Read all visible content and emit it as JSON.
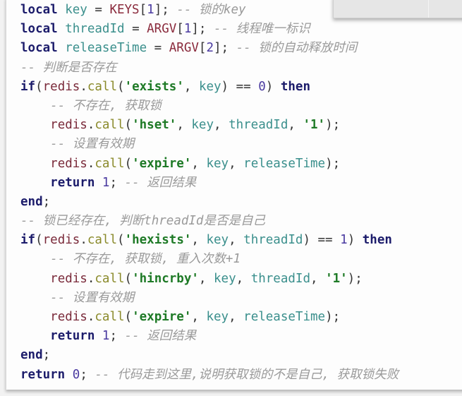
{
  "code": {
    "lines": [
      [
        [
          "kw",
          "local"
        ],
        [
          "punc",
          " "
        ],
        [
          "var",
          "key"
        ],
        [
          "punc",
          " = "
        ],
        [
          "glob",
          "KEYS"
        ],
        [
          "punc",
          "["
        ],
        [
          "num",
          "1"
        ],
        [
          "punc",
          "]; "
        ],
        [
          "cmt",
          "-- 锁的key"
        ]
      ],
      [
        [
          "kw",
          "local"
        ],
        [
          "punc",
          " "
        ],
        [
          "var",
          "threadId"
        ],
        [
          "punc",
          " = "
        ],
        [
          "glob",
          "ARGV"
        ],
        [
          "punc",
          "["
        ],
        [
          "num",
          "1"
        ],
        [
          "punc",
          "]; "
        ],
        [
          "cmt",
          "-- 线程唯一标识"
        ]
      ],
      [
        [
          "kw",
          "local"
        ],
        [
          "punc",
          " "
        ],
        [
          "var",
          "releaseTime"
        ],
        [
          "punc",
          " = "
        ],
        [
          "glob",
          "ARGV"
        ],
        [
          "punc",
          "["
        ],
        [
          "num",
          "2"
        ],
        [
          "punc",
          "]; "
        ],
        [
          "cmt",
          "-- 锁的自动释放时间"
        ]
      ],
      [
        [
          "cmt",
          "-- 判断是否存在"
        ]
      ],
      [
        [
          "kw",
          "if"
        ],
        [
          "punc",
          "("
        ],
        [
          "obj",
          "redis"
        ],
        [
          "punc",
          "."
        ],
        [
          "fn",
          "call"
        ],
        [
          "punc",
          "("
        ],
        [
          "str",
          "'exists'"
        ],
        [
          "punc",
          ", "
        ],
        [
          "var",
          "key"
        ],
        [
          "punc",
          ") == "
        ],
        [
          "num",
          "0"
        ],
        [
          "punc",
          ") "
        ],
        [
          "kw",
          "then"
        ]
      ],
      [
        [
          "punc",
          "    "
        ],
        [
          "cmt",
          "-- 不存在, 获取锁"
        ]
      ],
      [
        [
          "punc",
          "    "
        ],
        [
          "obj",
          "redis"
        ],
        [
          "punc",
          "."
        ],
        [
          "fn",
          "call"
        ],
        [
          "punc",
          "("
        ],
        [
          "str",
          "'hset'"
        ],
        [
          "punc",
          ", "
        ],
        [
          "var",
          "key"
        ],
        [
          "punc",
          ", "
        ],
        [
          "var",
          "threadId"
        ],
        [
          "punc",
          ", "
        ],
        [
          "str",
          "'1'"
        ],
        [
          "punc",
          ");"
        ]
      ],
      [
        [
          "punc",
          "    "
        ],
        [
          "cmt",
          "-- 设置有效期"
        ]
      ],
      [
        [
          "punc",
          "    "
        ],
        [
          "obj",
          "redis"
        ],
        [
          "punc",
          "."
        ],
        [
          "fn",
          "call"
        ],
        [
          "punc",
          "("
        ],
        [
          "str",
          "'expire'"
        ],
        [
          "punc",
          ", "
        ],
        [
          "var",
          "key"
        ],
        [
          "punc",
          ", "
        ],
        [
          "var",
          "releaseTime"
        ],
        [
          "punc",
          ");"
        ]
      ],
      [
        [
          "punc",
          "    "
        ],
        [
          "kw",
          "return"
        ],
        [
          "punc",
          " "
        ],
        [
          "num",
          "1"
        ],
        [
          "punc",
          "; "
        ],
        [
          "cmt",
          "-- 返回结果"
        ]
      ],
      [
        [
          "kw",
          "end"
        ],
        [
          "punc",
          ";"
        ]
      ],
      [
        [
          "cmt",
          "-- 锁已经存在, 判断threadId是否是自己"
        ]
      ],
      [
        [
          "kw",
          "if"
        ],
        [
          "punc",
          "("
        ],
        [
          "obj",
          "redis"
        ],
        [
          "punc",
          "."
        ],
        [
          "fn",
          "call"
        ],
        [
          "punc",
          "("
        ],
        [
          "str",
          "'hexists'"
        ],
        [
          "punc",
          ", "
        ],
        [
          "var",
          "key"
        ],
        [
          "punc",
          ", "
        ],
        [
          "var",
          "threadId"
        ],
        [
          "punc",
          ") == "
        ],
        [
          "num",
          "1"
        ],
        [
          "punc",
          ") "
        ],
        [
          "kw",
          "then"
        ]
      ],
      [
        [
          "punc",
          "    "
        ],
        [
          "cmt",
          "-- 不存在, 获取锁, 重入次数+1"
        ]
      ],
      [
        [
          "punc",
          "    "
        ],
        [
          "obj",
          "redis"
        ],
        [
          "punc",
          "."
        ],
        [
          "fn",
          "call"
        ],
        [
          "punc",
          "("
        ],
        [
          "str",
          "'hincrby'"
        ],
        [
          "punc",
          ", "
        ],
        [
          "var",
          "key"
        ],
        [
          "punc",
          ", "
        ],
        [
          "var",
          "threadId"
        ],
        [
          "punc",
          ", "
        ],
        [
          "str",
          "'1'"
        ],
        [
          "punc",
          ");"
        ]
      ],
      [
        [
          "punc",
          "    "
        ],
        [
          "cmt",
          "-- 设置有效期"
        ]
      ],
      [
        [
          "punc",
          "    "
        ],
        [
          "obj",
          "redis"
        ],
        [
          "punc",
          "."
        ],
        [
          "fn",
          "call"
        ],
        [
          "punc",
          "("
        ],
        [
          "str",
          "'expire'"
        ],
        [
          "punc",
          ", "
        ],
        [
          "var",
          "key"
        ],
        [
          "punc",
          ", "
        ],
        [
          "var",
          "releaseTime"
        ],
        [
          "punc",
          ");"
        ]
      ],
      [
        [
          "punc",
          "    "
        ],
        [
          "kw",
          "return"
        ],
        [
          "punc",
          " "
        ],
        [
          "num",
          "1"
        ],
        [
          "punc",
          "; "
        ],
        [
          "cmt",
          "-- 返回结果"
        ]
      ],
      [
        [
          "kw",
          "end"
        ],
        [
          "punc",
          ";"
        ]
      ],
      [
        [
          "kw",
          "return"
        ],
        [
          "punc",
          " "
        ],
        [
          "num",
          "0"
        ],
        [
          "punc",
          "; "
        ],
        [
          "cmt",
          "-- 代码走到这里,说明获取锁的不是自己, 获取锁失败"
        ]
      ]
    ]
  }
}
